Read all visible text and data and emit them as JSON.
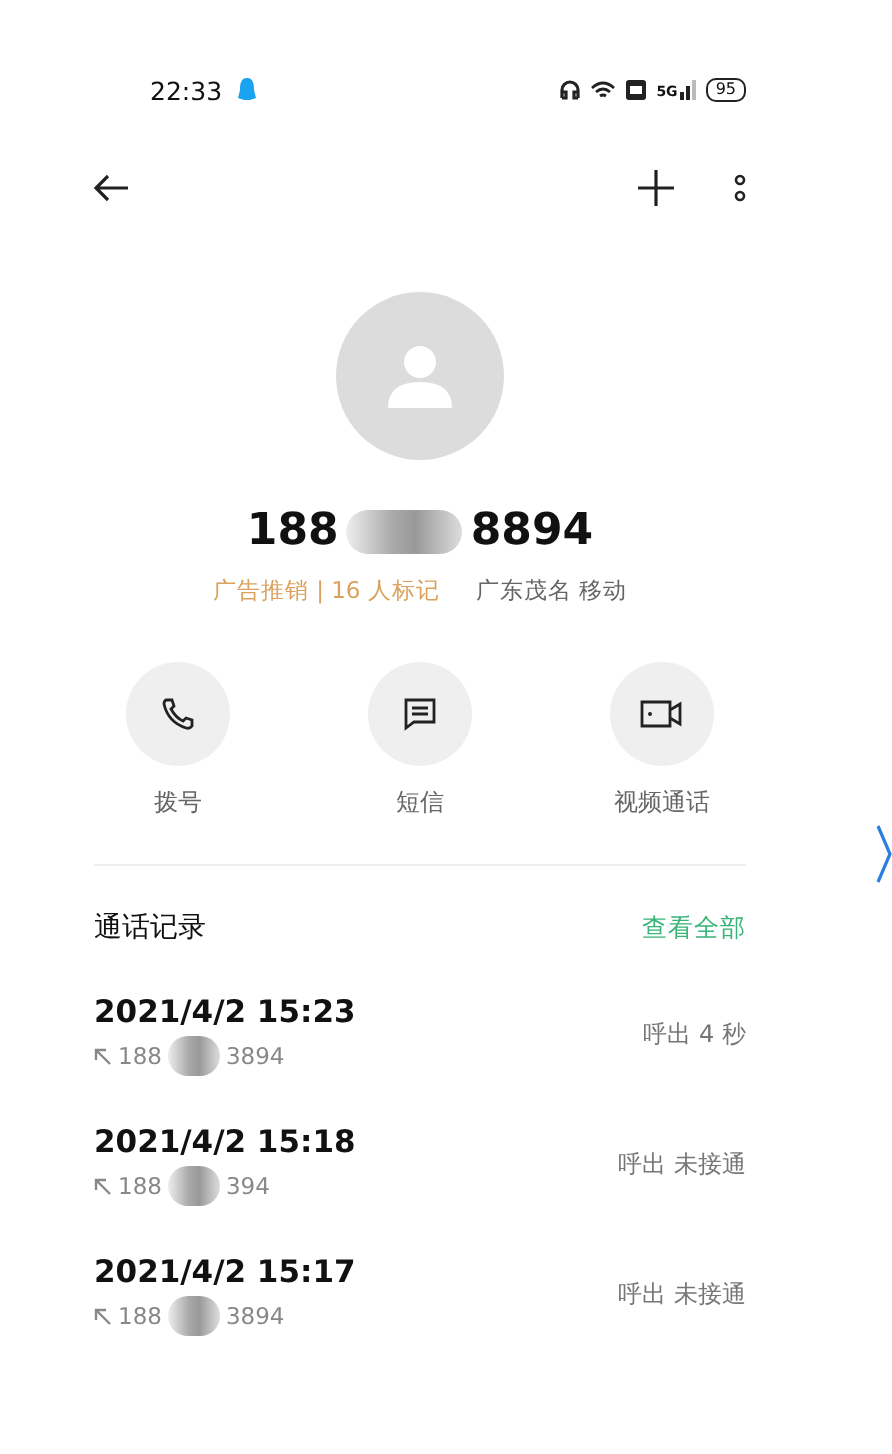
{
  "status_bar": {
    "time": "22:33",
    "network": "5G",
    "battery": "95"
  },
  "contact": {
    "number_prefix": "188",
    "number_suffix": "8894",
    "tag": "广告推销 | 16 人标记",
    "location": "广东茂名 移动"
  },
  "actions": [
    {
      "kind": "call",
      "label": "拨号"
    },
    {
      "kind": "message",
      "label": "短信"
    },
    {
      "kind": "video",
      "label": "视频通话"
    }
  ],
  "call_log": {
    "title": "通话记录",
    "view_all": "查看全部",
    "rows": [
      {
        "time": "2021/4/2 15:23",
        "number_prefix": "188",
        "number_suffix": "3894",
        "status": "呼出  4 秒"
      },
      {
        "time": "2021/4/2 15:18",
        "number_prefix": "188",
        "number_suffix": "394",
        "status": "呼出 未接通"
      },
      {
        "time": "2021/4/2 15:17",
        "number_prefix": "188",
        "number_suffix": "3894",
        "status": "呼出 未接通"
      }
    ]
  }
}
